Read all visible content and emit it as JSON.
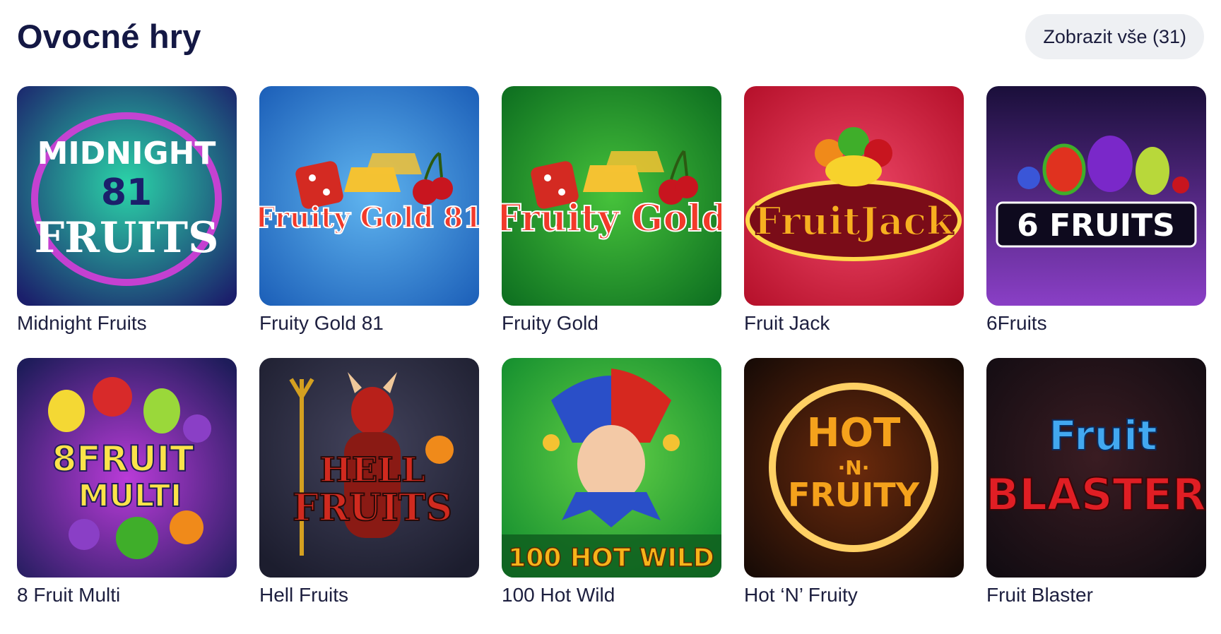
{
  "section": {
    "title": "Ovocné hry",
    "show_all_label": "Zobrazit vše (31)"
  },
  "games": [
    {
      "name": "Midnight Fruits",
      "art": {
        "line1": "MIDNIGHT",
        "line2": "81",
        "line3": "FRUITS",
        "bg": [
          "#1b1f6b",
          "#2bd4a8"
        ],
        "text": "#ffffff",
        "accent": "#d63dd9"
      }
    },
    {
      "name": "Fruity Gold 81",
      "art": {
        "line1": "Fruity Gold 81",
        "bg": [
          "#1c5fb8",
          "#5fb4ef"
        ],
        "text": "#f23a2a",
        "accent": "#f4c232"
      }
    },
    {
      "name": "Fruity Gold",
      "art": {
        "line1": "Fruity Gold",
        "bg": [
          "#0d6e20",
          "#46c23b"
        ],
        "text": "#f23a2a",
        "accent": "#f4c232"
      }
    },
    {
      "name": "Fruit Jack",
      "art": {
        "line1": "FruitJack",
        "bg": [
          "#b5102a",
          "#ef4868"
        ],
        "text": "#f7b020",
        "accent": "#ffd84a"
      }
    },
    {
      "name": "6Fruits",
      "art": {
        "line1": "6 FRUITS",
        "bg": [
          "#1a0f3a",
          "#8a3fc6"
        ],
        "text": "#ffffff",
        "accent": "#7a28c9"
      }
    },
    {
      "name": "8 Fruit Multi",
      "art": {
        "line1": "8FRUIT",
        "line2": "MULTI",
        "bg": [
          "#1e1c5a",
          "#b93bd8"
        ],
        "text": "#fbe34a",
        "accent": "#38c6e8"
      }
    },
    {
      "name": "Hell Fruits",
      "art": {
        "line1": "HELL",
        "line2": "FRUITS",
        "bg": [
          "#1c1d2e",
          "#43435c"
        ],
        "text": "#d02a1f",
        "accent": "#f08a1a"
      }
    },
    {
      "name": "100 Hot Wild",
      "art": {
        "line1": "100 HOT WILD",
        "bg": [
          "#118c2e",
          "#63d046"
        ],
        "text": "#f6b41a",
        "accent": "#d6281f"
      }
    },
    {
      "name": "Hot ‘N’ Fruity",
      "art": {
        "line1": "HOT",
        "line2": "·N·",
        "line3": "FRUITY",
        "bg": [
          "#150a06",
          "#6b2a0c"
        ],
        "text": "#f5a21c",
        "accent": "#ffd064"
      }
    },
    {
      "name": "Fruit Blaster",
      "art": {
        "line1": "Fruit",
        "line2": "BLASTER",
        "bg": [
          "#120c12",
          "#3a1c22"
        ],
        "text": "#e01e24",
        "accent": "#42a8f0"
      }
    }
  ]
}
